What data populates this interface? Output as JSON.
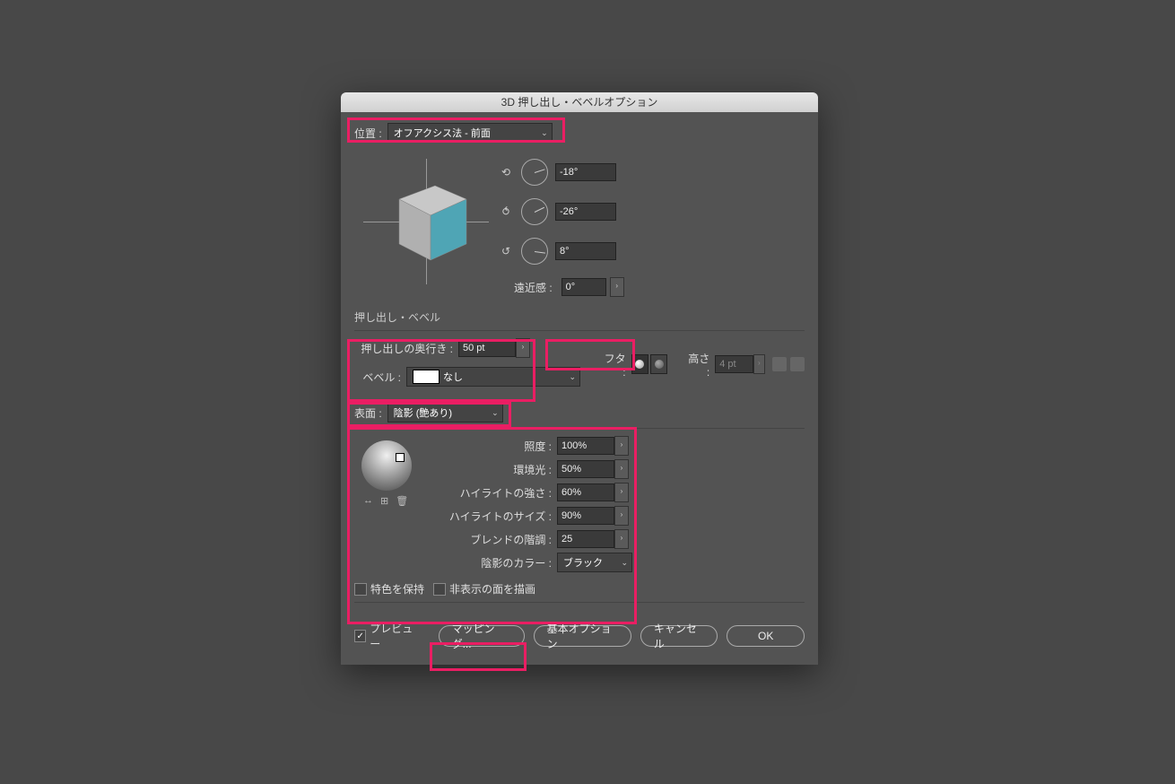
{
  "title": "3D 押し出し・ベベルオプション",
  "position": {
    "label": "位置 :",
    "value": "オフアクシス法 - 前面"
  },
  "rotation": {
    "x": "-18°",
    "y": "-26°",
    "z": "8°",
    "perspective_label": "遠近感 :",
    "perspective_value": "0°"
  },
  "extrude_section": {
    "title": "押し出し・ベベル",
    "depth_label": "押し出しの奥行き :",
    "depth_value": "50 pt",
    "bevel_label": "ベベル :",
    "bevel_value": "なし",
    "cap_label": "フタ :",
    "height_label": "高さ :",
    "height_value": "4 pt"
  },
  "surface": {
    "label": "表面 :",
    "value": "陰影 (艶あり)"
  },
  "lighting": {
    "intensity_label": "照度 :",
    "intensity_value": "100%",
    "ambient_label": "環境光 :",
    "ambient_value": "50%",
    "highlight_intensity_label": "ハイライトの強さ :",
    "highlight_intensity_value": "60%",
    "highlight_size_label": "ハイライトのサイズ :",
    "highlight_size_value": "90%",
    "blend_steps_label": "ブレンドの階調 :",
    "blend_steps_value": "25",
    "shade_color_label": "陰影のカラー :",
    "shade_color_value": "ブラック"
  },
  "checkboxes": {
    "preserve_spot": "特色を保持",
    "draw_hidden": "非表示の面を描画"
  },
  "footer": {
    "preview": "プレビュー",
    "mapping": "マッピング...",
    "basic_options": "基本オプション",
    "cancel": "キャンセル",
    "ok": "OK"
  }
}
